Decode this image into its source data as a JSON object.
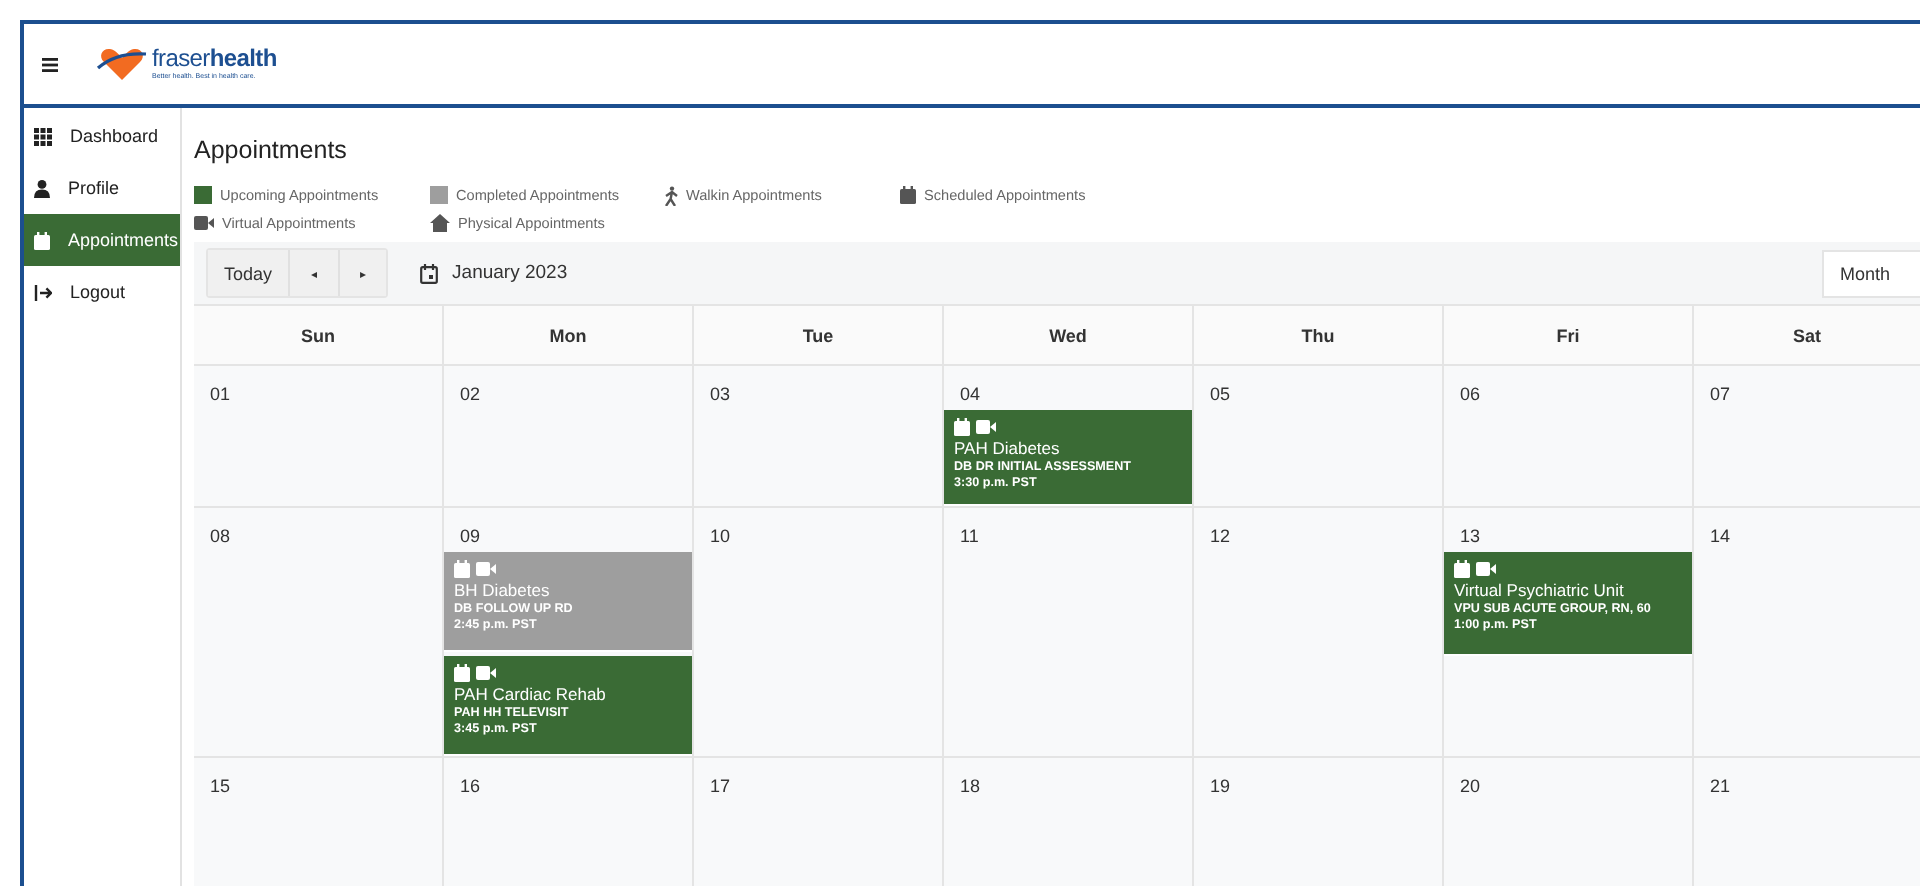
{
  "header": {
    "brand_light": "fraser",
    "brand_bold": "health",
    "tagline": "Better health. Best in health care."
  },
  "sidebar": {
    "items": [
      {
        "label": "Dashboard",
        "selected": false
      },
      {
        "label": "Profile",
        "selected": false
      },
      {
        "label": "Appointments",
        "selected": true
      },
      {
        "label": "Logout",
        "selected": false
      }
    ]
  },
  "page_title": "Appointments",
  "legend": [
    {
      "label": "Upcoming Appointments",
      "kind": "swatch",
      "color": "#3a6b35"
    },
    {
      "label": "Completed Appointments",
      "kind": "swatch",
      "color": "#9e9e9e"
    },
    {
      "label": "Walkin Appointments",
      "kind": "walkin"
    },
    {
      "label": "Scheduled Appointments",
      "kind": "scheduled"
    },
    {
      "label": "Virtual Appointments",
      "kind": "virtual"
    },
    {
      "label": "Physical Appointments",
      "kind": "physical"
    }
  ],
  "toolbar": {
    "today": "Today",
    "prev": "◂",
    "next": "▸",
    "month_label": "January 2023",
    "view": "Month"
  },
  "calendar": {
    "weekdays": [
      "Sun",
      "Mon",
      "Tue",
      "Wed",
      "Thu",
      "Fri",
      "Sat"
    ],
    "weeks": [
      [
        {
          "date": "01"
        },
        {
          "date": "02"
        },
        {
          "date": "03"
        },
        {
          "date": "04",
          "events": [
            {
              "completed": false,
              "scheduled": true,
              "virtual": true,
              "title": "PAH Diabetes",
              "detail": "DB DR INITIAL ASSESSMENT",
              "time": "3:30 p.m. PST"
            }
          ]
        },
        {
          "date": "05"
        },
        {
          "date": "06"
        },
        {
          "date": "07"
        }
      ],
      [
        {
          "date": "08"
        },
        {
          "date": "09",
          "events": [
            {
              "completed": true,
              "scheduled": true,
              "virtual": true,
              "title": "BH Diabetes",
              "detail": "DB FOLLOW UP RD",
              "time": "2:45 p.m. PST"
            },
            {
              "completed": false,
              "scheduled": true,
              "virtual": true,
              "title": "PAH Cardiac Rehab",
              "detail": "PAH HH TELEVISIT",
              "time": "3:45 p.m. PST"
            }
          ]
        },
        {
          "date": "10"
        },
        {
          "date": "11"
        },
        {
          "date": "12"
        },
        {
          "date": "13",
          "events": [
            {
              "completed": false,
              "scheduled": true,
              "virtual": true,
              "title": "Virtual Psychiatric Unit",
              "detail": "VPU SUB ACUTE GROUP, RN, 60",
              "time": "1:00 p.m. PST"
            }
          ]
        },
        {
          "date": "14"
        }
      ],
      [
        {
          "date": "15"
        },
        {
          "date": "16"
        },
        {
          "date": "17"
        },
        {
          "date": "18"
        },
        {
          "date": "19"
        },
        {
          "date": "20"
        },
        {
          "date": "21"
        }
      ]
    ]
  }
}
